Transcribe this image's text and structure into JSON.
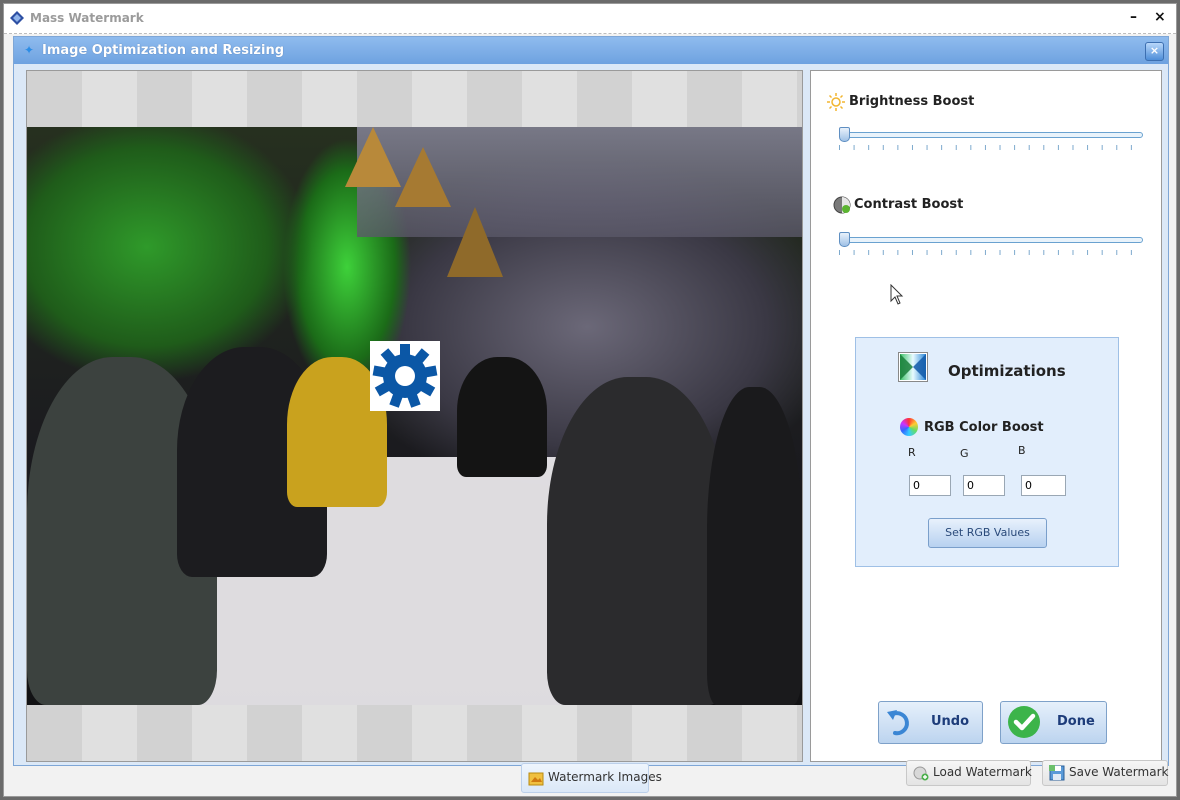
{
  "window": {
    "title": "Mass Watermark",
    "minimize_label": "–",
    "close_label": "×"
  },
  "dialog": {
    "title": "Image Optimization and Resizing",
    "close_label": "×"
  },
  "settings": {
    "brightness": {
      "label": "Brightness Boost",
      "value_fraction": 0.0
    },
    "contrast": {
      "label": "Contrast Boost",
      "value_fraction": 0.0
    },
    "optimizations": {
      "title": "Optimizations",
      "rgb_title": "RGB Color Boost",
      "channels": [
        {
          "label": "R",
          "value": "0"
        },
        {
          "label": "G",
          "value": "0"
        },
        {
          "label": "B",
          "value": "0"
        }
      ],
      "set_button": "Set RGB Values"
    },
    "undo_button": "Undo",
    "done_button": "Done"
  },
  "bottom_toolbar": {
    "watermark_images": "Watermark Images",
    "load_watermark": "Load Watermark",
    "save_watermark": "Save Watermark"
  },
  "colors": {
    "accent": "#6ea2e0",
    "logo_blue": "#0b57a6",
    "panel_bg": "#e2eefc"
  }
}
